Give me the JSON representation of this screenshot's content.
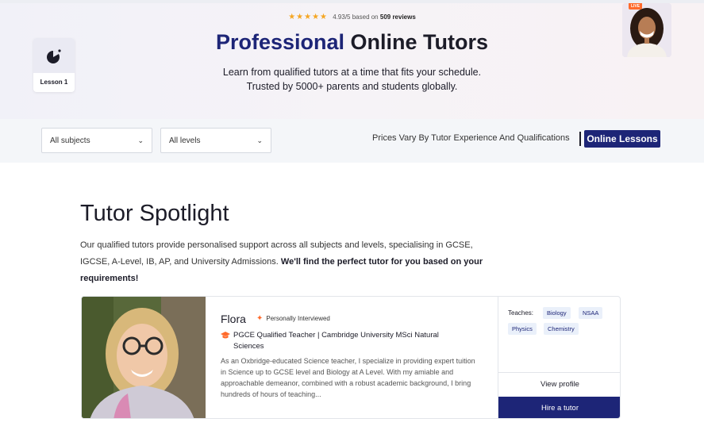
{
  "hero": {
    "stars": "★★★★★",
    "rating_text": "4.93/5 based on",
    "reviews": "509 reviews",
    "title_accent": "Professional",
    "title_rest": "Online Tutors",
    "subtitle_line1": "Learn from qualified tutors at a time that fits your schedule.",
    "subtitle_line2": "Trusted by 5000+ parents and students globally.",
    "lesson_label": "Lesson 1",
    "live_badge": "LIVE"
  },
  "filters": {
    "subjects": "All subjects",
    "levels": "All levels",
    "prices_text": "Prices Vary By Tutor Experience And Qualifications",
    "online_button": "Online Lessons"
  },
  "spotlight": {
    "title": "Tutor Spotlight",
    "desc_plain": "Our qualified tutors provide personalised support across all subjects and levels, specialising in GCSE, IGCSE, A-Level, IB, AP, and University Admissions.",
    "desc_bold": "We'll find the perfect tutor for you based on your requirements!"
  },
  "tutor": {
    "name": "Flora",
    "badge": "Personally Interviewed",
    "qualification": "PGCE Qualified Teacher | Cambridge University MSci Natural Sciences",
    "bio": "As an Oxbridge-educated Science teacher, I specialize in providing expert tuition in Science up to GCSE level and Biology at A Level. With my amiable and approachable demeanor, combined with a robust academic background, I bring hundreds of hours of teaching...",
    "teaches_label": "Teaches:",
    "subjects": [
      "Biology",
      "NSAA",
      "Physics",
      "Chemistry"
    ],
    "view_profile": "View profile",
    "hire": "Hire a tutor"
  },
  "colors": {
    "brand": "#1d2577",
    "accent_orange": "#ff6a2b",
    "star": "#f5a623"
  }
}
